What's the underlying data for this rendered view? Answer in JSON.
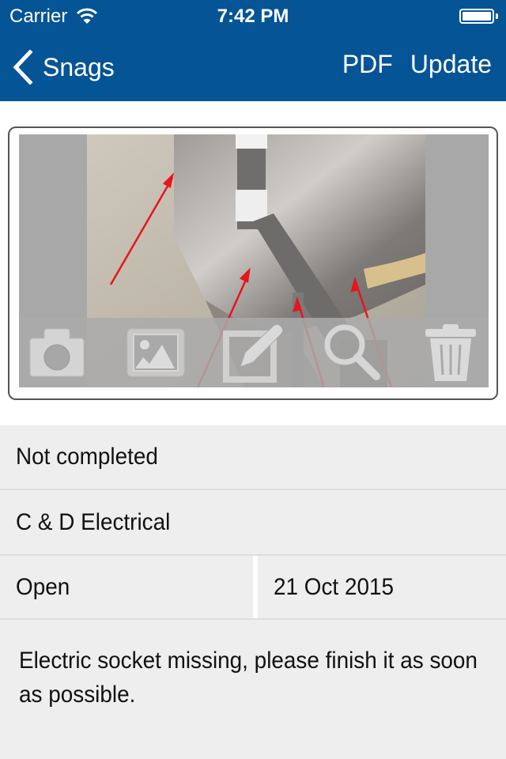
{
  "status_bar": {
    "carrier": "Carrier",
    "time": "7:42 PM",
    "battery_percent": 100
  },
  "nav": {
    "back_label": "Snags",
    "actions": [
      "PDF",
      "Update"
    ]
  },
  "photo_toolbar": {
    "tools": [
      {
        "name": "camera",
        "icon": "camera-icon"
      },
      {
        "name": "gallery",
        "icon": "image-icon"
      },
      {
        "name": "annotate",
        "icon": "edit-icon"
      },
      {
        "name": "zoom",
        "icon": "magnifier-icon"
      },
      {
        "name": "delete",
        "icon": "trash-icon"
      }
    ]
  },
  "details": {
    "completion_status": "Not completed",
    "contractor": "C & D Electrical",
    "state": "Open",
    "date": "21 Oct 2015",
    "description": "Electric socket missing, please finish it as soon as possible."
  },
  "colors": {
    "nav_bar": "#055496",
    "row_bg": "#eeeeee",
    "annotation_arrow": "#e8141e"
  }
}
